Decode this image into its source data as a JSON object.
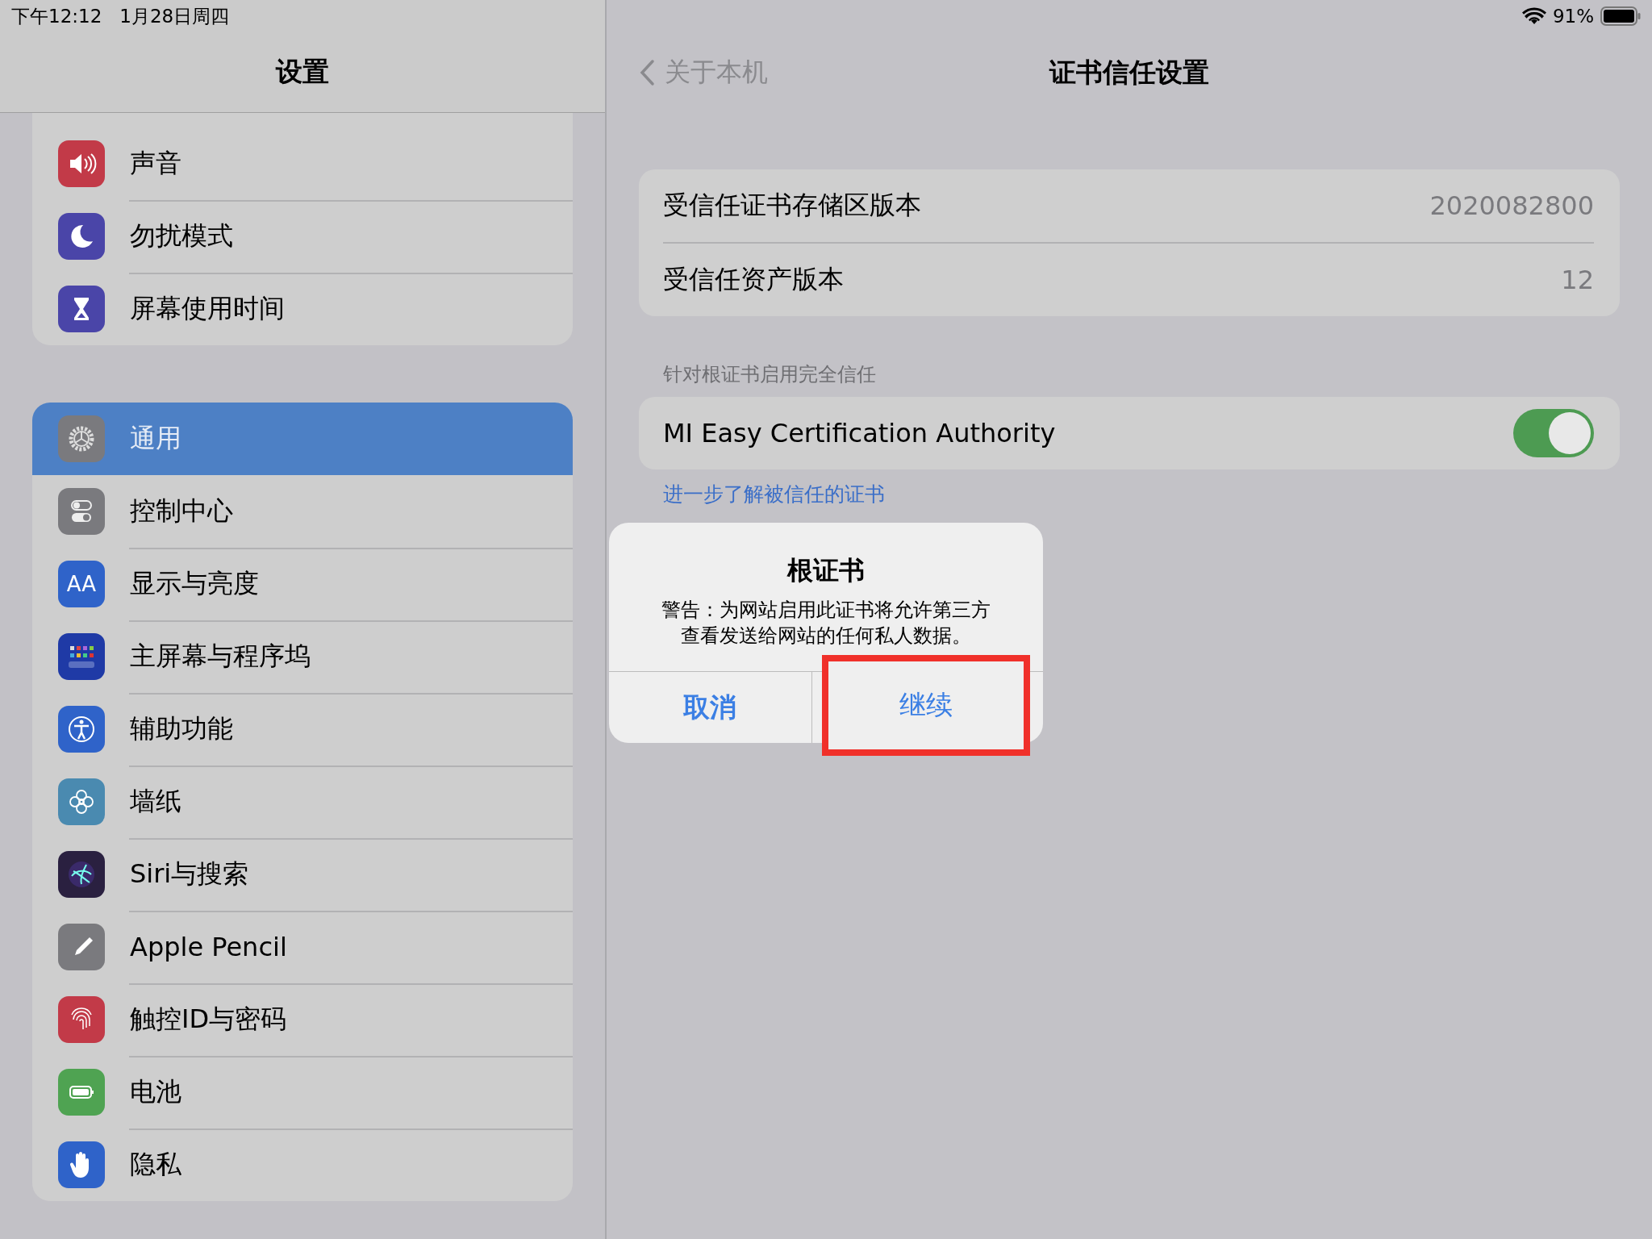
{
  "status_bar": {
    "time": "下午12:12",
    "date": "1月28日周四",
    "battery": "91%"
  },
  "sidebar": {
    "title": "设置",
    "groups": [
      {
        "items": [
          {
            "label": "声音",
            "color": "#c23a48",
            "selected": false
          },
          {
            "label": "勿扰模式",
            "color": "#4a45a8",
            "selected": false
          },
          {
            "label": "屏幕使用时间",
            "color": "#4a45a8",
            "selected": false
          }
        ]
      },
      {
        "items": [
          {
            "label": "通用",
            "color": "#7a7a7e",
            "selected": true
          },
          {
            "label": "控制中心",
            "color": "#7a7a7e",
            "selected": false
          },
          {
            "label": "显示与亮度",
            "color": "#2f63c9",
            "selected": false,
            "icon_label": "AA"
          },
          {
            "label": "主屏幕与程序坞",
            "color": "#1f3aa6",
            "selected": false
          },
          {
            "label": "辅助功能",
            "color": "#2f63c9",
            "selected": false
          },
          {
            "label": "墙纸",
            "color": "#4a8ab0",
            "selected": false
          },
          {
            "label": "Siri与搜索",
            "color": "#2a2040",
            "selected": false
          },
          {
            "label": "Apple Pencil",
            "color": "#7a7a7e",
            "selected": false
          },
          {
            "label": "触控ID与密码",
            "color": "#c23a48",
            "selected": false
          },
          {
            "label": "电池",
            "color": "#4fa352",
            "selected": false
          },
          {
            "label": "隐私",
            "color": "#2f63c9",
            "selected": false
          }
        ]
      }
    ]
  },
  "detail": {
    "back": "关于本机",
    "title": "证书信任设置",
    "info_rows": [
      {
        "label": "受信任证书存储区版本",
        "value": "2020082800"
      },
      {
        "label": "受信任资产版本",
        "value": "12"
      }
    ],
    "section_header": "针对根证书启用完全信任",
    "certificates": [
      {
        "name": "MI Easy Certification Authority",
        "on": true
      }
    ],
    "link": "进一步了解被信任的证书"
  },
  "alert": {
    "title": "根证书",
    "message": "警告：为网站启用此证书将允许第三方查看发送给网站的任何私人数据。",
    "buttons": [
      {
        "label": "取消",
        "highlighted": false
      },
      {
        "label": "继续",
        "highlighted": true
      }
    ]
  }
}
